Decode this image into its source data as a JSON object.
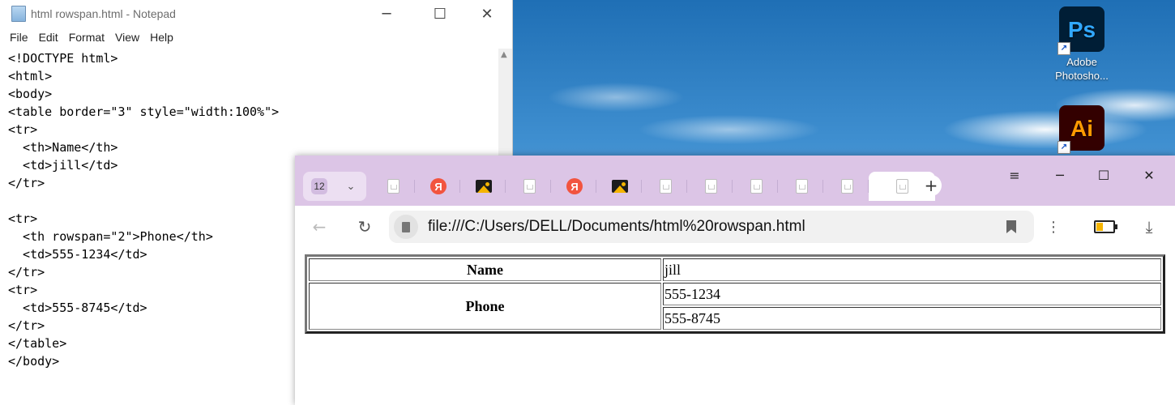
{
  "notepad": {
    "title": "html rowspan.html - Notepad",
    "menu": [
      "File",
      "Edit",
      "Format",
      "View",
      "Help"
    ],
    "controls": {
      "minimize": "─",
      "maximize": "☐",
      "close": "✕"
    },
    "content": "<!DOCTYPE html>\n<html>\n<body>\n<table border=\"3\" style=\"width:100%\">\n<tr>\n  <th>Name</th>\n  <td>jill</td>\n</tr>\n\n<tr>\n  <th rowspan=\"2\">Phone</th>\n  <td>555-1234</td>\n</tr>\n<tr>\n  <td>555-8745</td>\n</tr>\n</table>\n</body>"
  },
  "desktop": {
    "icons": [
      {
        "label": "Adobe\nPhotosho...",
        "glyph": "Ps",
        "bg": "#001e36",
        "fg": "#31a8ff"
      },
      {
        "label": "",
        "glyph": "Ai",
        "bg": "#330000",
        "fg": "#ff9a00"
      }
    ]
  },
  "browser": {
    "tab_count": "12",
    "url": "file:///C:/Users/DELL/Documents/html%20rowspan.html",
    "controls": {
      "menu": "≡",
      "minimize": "─",
      "maximize": "☐",
      "close": "✕"
    },
    "tabs": [
      "doc",
      "yandex",
      "image",
      "doc",
      "yandex",
      "image",
      "doc",
      "doc",
      "doc",
      "doc",
      "doc",
      "doc-active"
    ],
    "yandex_letter": "Я"
  },
  "table": {
    "name_header": "Name",
    "name_value": "jill",
    "phone_header": "Phone",
    "phone_values": [
      "555-1234",
      "555-8745"
    ]
  }
}
